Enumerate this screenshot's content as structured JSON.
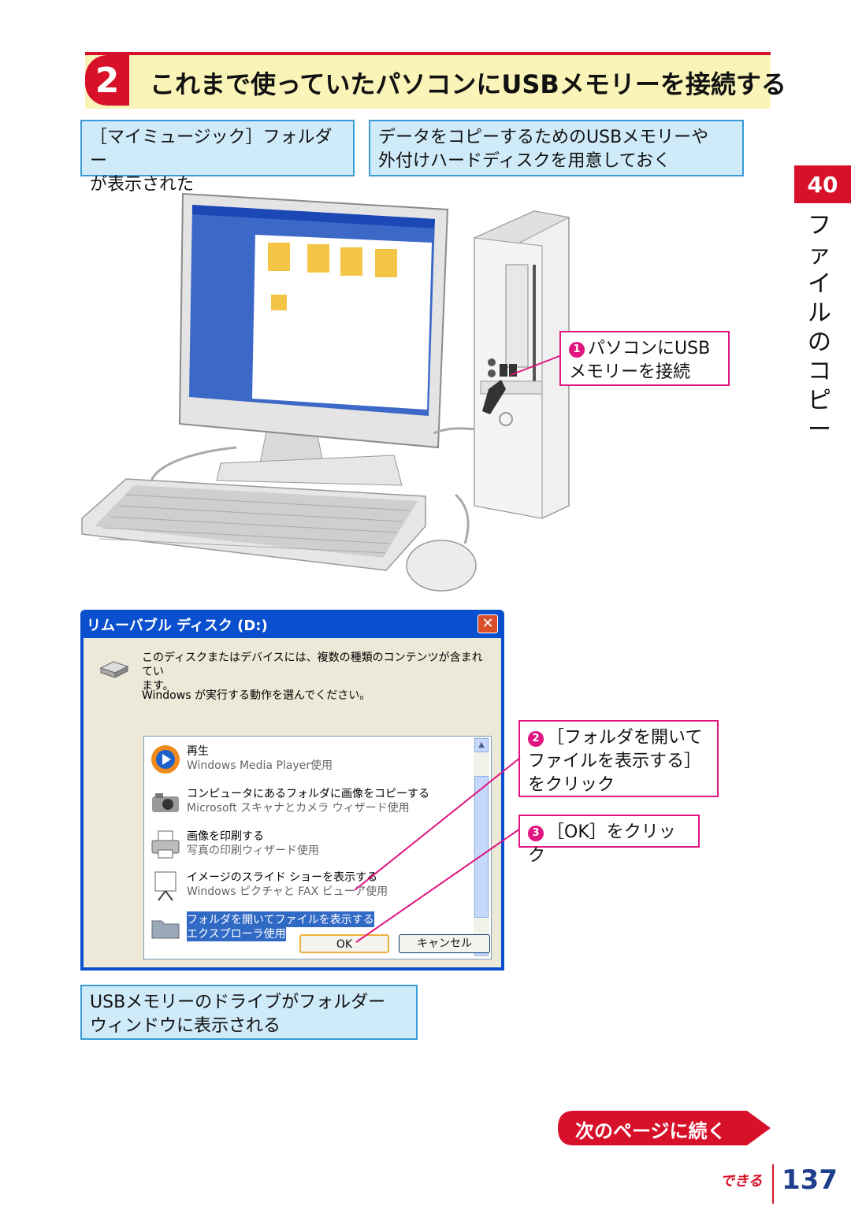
{
  "step": {
    "number": "2",
    "title": "これまで使っていたパソコンにUSBメモリーを接続する"
  },
  "notes": {
    "music_folder": "［マイミュージック］フォルダー\nが表示された",
    "prepare_usb": "データをコピーするためのUSBメモリーや\n外付けハードディスクを用意しておく",
    "result": "USBメモリーのドライブがフォルダー\nウィンドウに表示される"
  },
  "side": {
    "chapter_number": "40",
    "chapter_label": "ファイルのコピー"
  },
  "callouts": {
    "c1": {
      "num": "1",
      "text": "パソコンにUSB\nメモリーを接続"
    },
    "c2": {
      "num": "2",
      "text": "［フォルダを開いて\nファイルを表示する］\nをクリック"
    },
    "c3": {
      "num": "3",
      "text": "［OK］をクリック"
    }
  },
  "dialog": {
    "title": "リムーバブル ディスク (D:)",
    "message": "このディスクまたはデバイスには、複数の種類のコンテンツが含まれてい\nます。",
    "prompt": "Windows が実行する動作を選んでください。",
    "items": [
      {
        "title": "再生",
        "sub": "Windows Media Player使用",
        "icon": "media-player-icon"
      },
      {
        "title": "コンピュータにあるフォルダに画像をコピーする",
        "sub": "Microsoft スキャナとカメラ ウィザード使用",
        "icon": "camera-icon"
      },
      {
        "title": "画像を印刷する",
        "sub": "写真の印刷ウィザード使用",
        "icon": "printer-icon"
      },
      {
        "title": "イメージのスライド ショーを表示する",
        "sub": "Windows ピクチャと FAX ビューア使用",
        "icon": "slideshow-icon"
      },
      {
        "title": "フォルダを開いてファイルを表示する",
        "sub": "エクスプローラ使用",
        "icon": "folder-icon",
        "selected": true
      }
    ],
    "ok": "OK",
    "cancel": "キャンセル"
  },
  "continue_label": "次のページに続く",
  "footer": {
    "brand": "できる",
    "page": "137"
  },
  "colors": {
    "accent_red": "#d8112a",
    "callout_pink": "#e0157f",
    "note_blue": "#3a9ad6"
  }
}
